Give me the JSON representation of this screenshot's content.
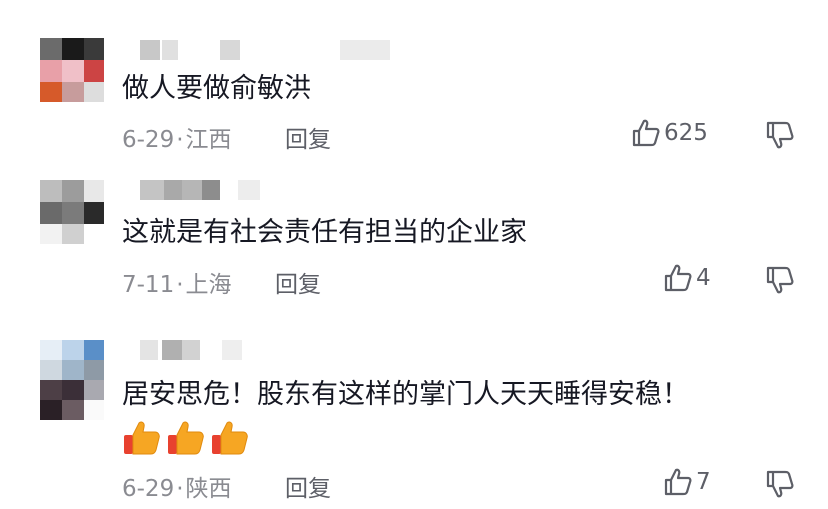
{
  "comments": [
    {
      "text": "做人要做俞敏洪",
      "date": "6-29",
      "location": "江西",
      "reply_label": "回复",
      "like_count": "625"
    },
    {
      "text": "这就是有社会责任有担当的企业家",
      "date": "7-11",
      "location": "上海",
      "reply_label": "回复",
      "like_count": "4"
    },
    {
      "text": "居安思危！股东有这样的掌门人天天睡得安稳！",
      "date": "6-29",
      "location": "陕西",
      "reply_label": "回复",
      "like_count": "7",
      "emoji": [
        "thumbs-up-icon",
        "thumbs-up-icon",
        "thumbs-up-icon"
      ]
    }
  ],
  "meta_separator": "·",
  "icons": {
    "like": "thumb-up-outline-icon",
    "dislike": "thumb-down-outline-icon"
  },
  "colors": {
    "text": "#161823",
    "meta": "#8a8b91",
    "action": "#5d5f67",
    "emoji": "#f5a623"
  }
}
